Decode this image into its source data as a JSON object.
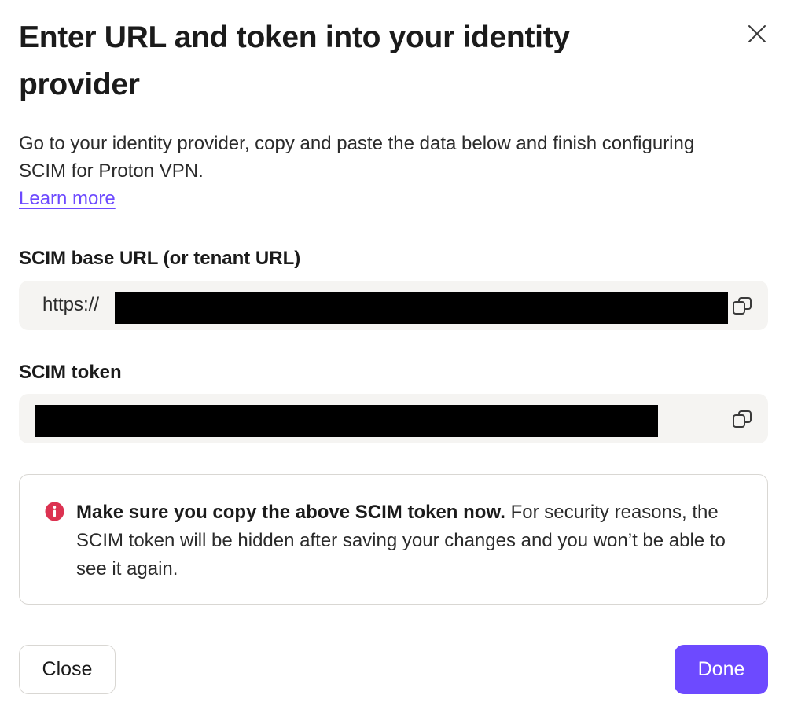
{
  "dialog": {
    "title": "Enter URL and token into your identity provider",
    "description": "Go to your identity provider, copy and paste the data below and finish configuring SCIM for Proton VPN.",
    "learn_more": "Learn more"
  },
  "fields": {
    "base_url": {
      "label": "SCIM base URL (or tenant URL)",
      "value_prefix": "https://"
    },
    "token": {
      "label": "SCIM token"
    }
  },
  "notice": {
    "bold": "Make sure you copy the above SCIM token now.",
    "text": " For security reasons, the SCIM token will be hidden after saving your changes and you won’t be able to see it again."
  },
  "buttons": {
    "close": "Close",
    "done": "Done"
  },
  "icons": {
    "close": "close-icon",
    "copy": "copy-icon",
    "info": "info-icon"
  },
  "colors": {
    "accent": "#6d4aff",
    "danger": "#dc3251",
    "field_bg": "#f5f4f2"
  }
}
